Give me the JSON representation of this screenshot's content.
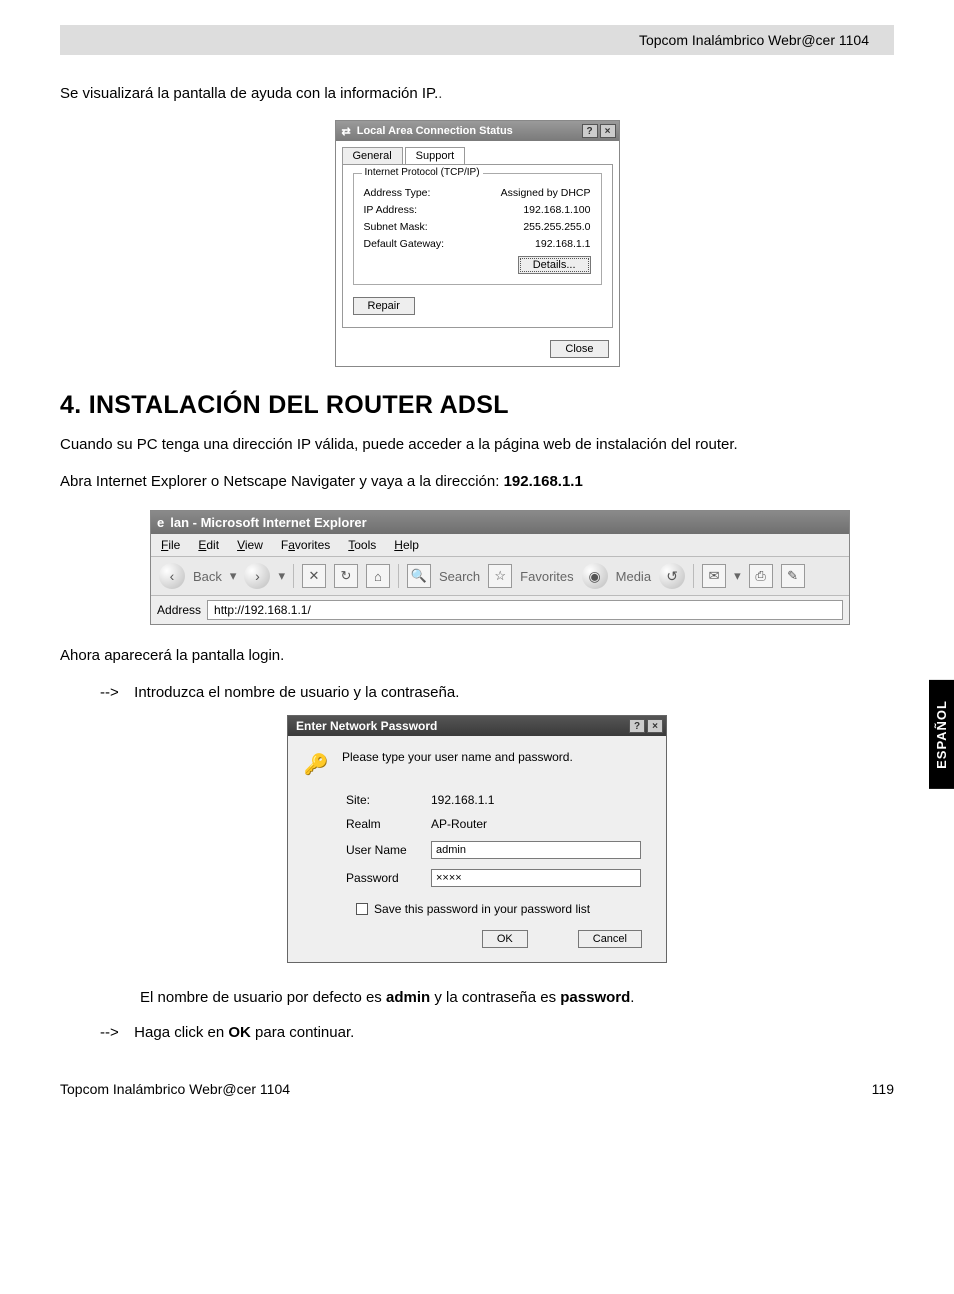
{
  "header": {
    "product": "Topcom Inalámbrico Webr@cer 1104"
  },
  "intro_text": "Se visualizará la pantalla de ayuda con la información IP.",
  "lan_status": {
    "title": "Local Area Connection Status",
    "tab_general": "General",
    "tab_support": "Support",
    "legend": "Internet Protocol (TCP/IP)",
    "rows": {
      "addr_type_l": "Address Type:",
      "addr_type_v": "Assigned by DHCP",
      "ip_l": "IP Address:",
      "ip_v": "192.168.1.100",
      "subnet_l": "Subnet Mask:",
      "subnet_v": "255.255.255.0",
      "gw_l": "Default Gateway:",
      "gw_v": "192.168.1.1"
    },
    "details_btn": "Details...",
    "repair_btn": "Repair",
    "close_btn": "Close"
  },
  "section4_title": "4. INSTALACIÓN DEL ROUTER ADSL",
  "para1": "Cuando su PC tenga una dirección IP válida, puede acceder a la página web de instalación del router.",
  "para2_a": "Abra Internet Explorer o Netscape Navigater y vaya a la dirección: ",
  "para2_b": "192.168.1.1",
  "ie": {
    "title": "lan - Microsoft Internet Explorer",
    "menu": {
      "file": "File",
      "edit": "Edit",
      "view": "View",
      "fav": "Favorites",
      "tools": "Tools",
      "help": "Help"
    },
    "tool": {
      "back": "Back",
      "search": "Search",
      "favorites": "Favorites",
      "media": "Media"
    },
    "addr_label": "Address",
    "addr_value": "http://192.168.1.1/"
  },
  "para3": "Ahora aparecerá la pantalla login.",
  "step1": "Introduzca el nombre de usuario y la contraseña.",
  "auth": {
    "title": "Enter Network Password",
    "prompt": "Please type your user name and password.",
    "site_l": "Site:",
    "site_v": "192.168.1.1",
    "realm_l": "Realm",
    "realm_v": "AP-Router",
    "user_l": "User Name",
    "user_v": "admin",
    "pass_l": "Password",
    "pass_v": "××××",
    "save_cb": "Save this password in your password list",
    "ok": "OK",
    "cancel": "Cancel"
  },
  "note_defaults_a": "El nombre de usuario por defecto es ",
  "note_defaults_b": "admin",
  "note_defaults_c": " y la contraseña es ",
  "note_defaults_d": "password",
  "note_defaults_e": ".",
  "step2_a": "Haga click en ",
  "step2_b": "OK",
  "step2_c": " para continuar.",
  "side_tab": "ESPAÑOL",
  "footer": {
    "left": "Topcom Inalámbrico Webr@cer 1104",
    "page": "119"
  },
  "glyphs": {
    "arrow": "-->",
    "help": "?",
    "close": "×",
    "back": "‹",
    "fwd": "›",
    "star": "☆",
    "globe": "◉",
    "mag": "🔍",
    "house": "⌂",
    "refresh": "↻",
    "stop": "✕",
    "mail": "✉",
    "key": "🔑"
  }
}
